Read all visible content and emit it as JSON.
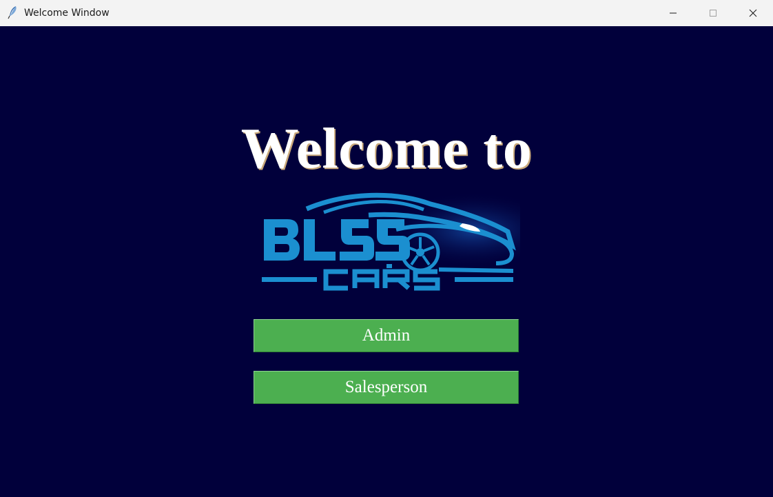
{
  "window": {
    "title": "Welcome Window",
    "app_icon": "feather-icon",
    "controls": {
      "minimize_icon": "minimize-icon",
      "maximize_icon": "maximize-icon",
      "close_icon": "close-icon"
    }
  },
  "main": {
    "heading": "Welcome to",
    "logo": {
      "icon": "blss-cars-logo",
      "text_main": "BLSS",
      "text_sub": "CARS"
    },
    "buttons": {
      "admin_label": "Admin",
      "salesperson_label": "Salesperson"
    }
  },
  "colors": {
    "background": "#01003b",
    "button": "#4caf50",
    "logo_blue": "#1b8fd0",
    "titlebar": "#f3f3f3"
  }
}
